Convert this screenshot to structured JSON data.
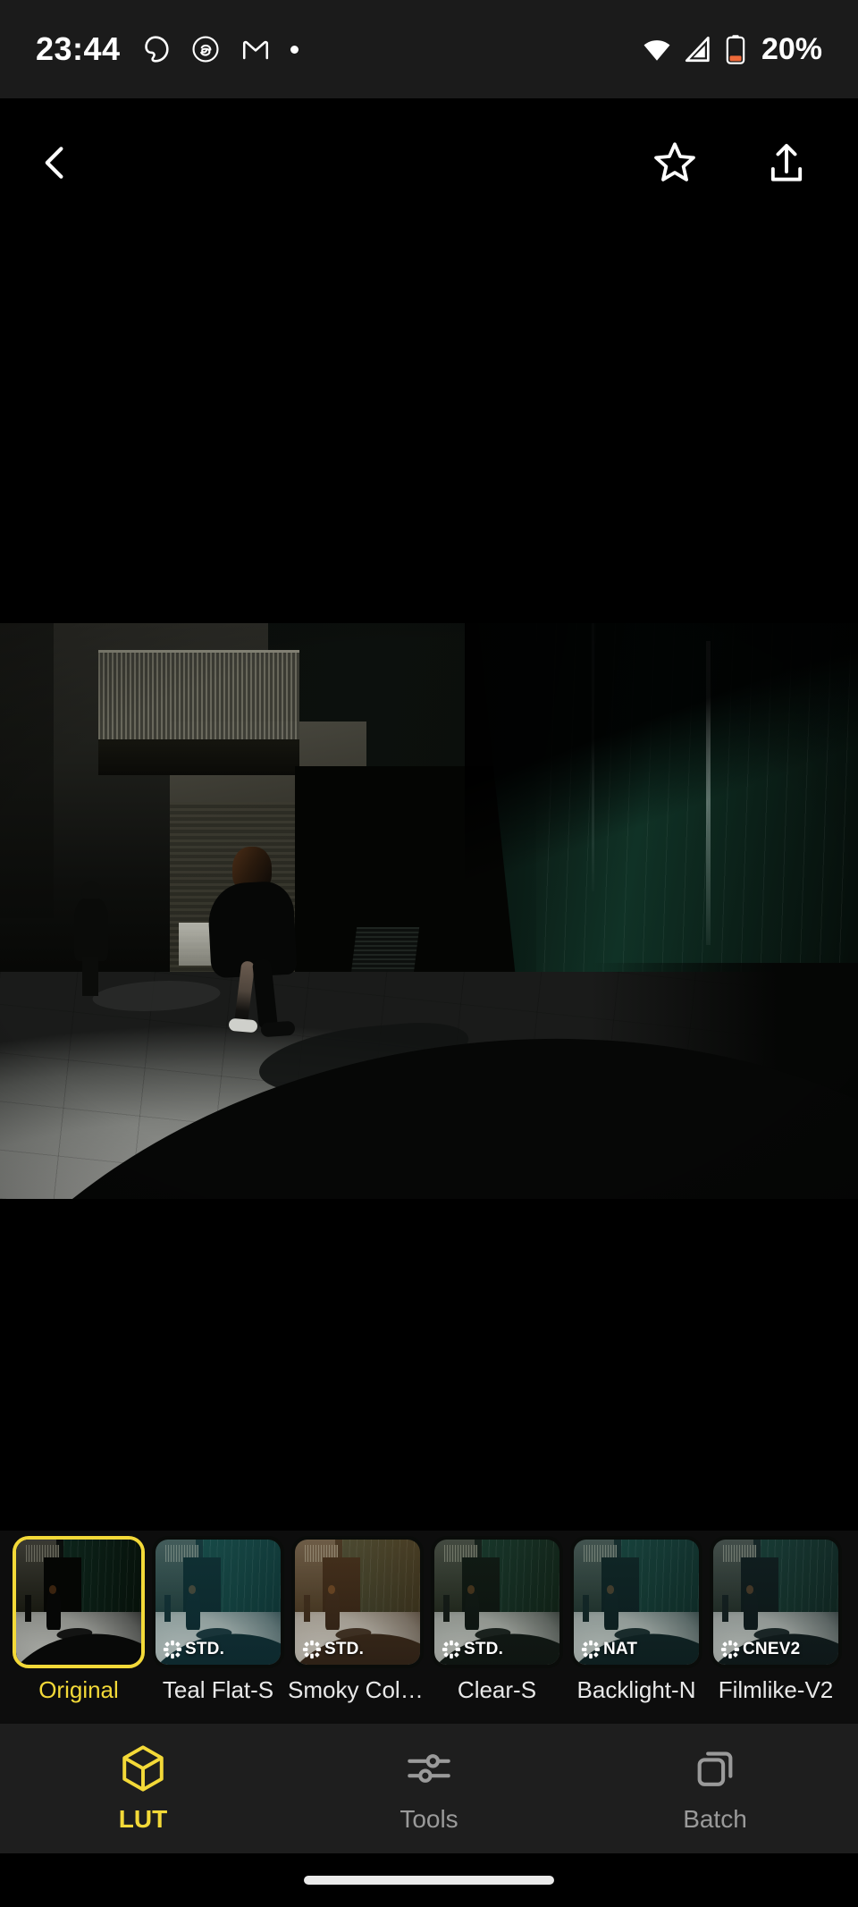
{
  "status_bar": {
    "time": "23:44",
    "battery_percent": "20%",
    "battery_color": "#ee6a3a",
    "icons": [
      "ring-icon",
      "threads-icon",
      "gmail-icon",
      "dot-icon",
      "wifi-icon",
      "cellular-signal-icon",
      "battery-icon"
    ]
  },
  "toolbar": {
    "back_icon": "chevron-left-icon",
    "favorite_icon": "star-outline-icon",
    "share_icon": "share-upload-icon"
  },
  "photo": {
    "alt": "Dark street photo of a woman walking through a patch of sunlight on paving stones beside a glass-clad building",
    "background_color": "#000000"
  },
  "lut_strip": {
    "background_color": "#0d0d0d",
    "selected_color": "#f3d938",
    "items": [
      {
        "label": "Original",
        "badge": "",
        "selected": true,
        "tint": "none"
      },
      {
        "label": "Teal Flat-S",
        "badge": "STD.",
        "selected": false,
        "tint": "teal"
      },
      {
        "label": "Smoky Colo...",
        "badge": "STD.",
        "selected": false,
        "tint": "smoky"
      },
      {
        "label": "Clear-S",
        "badge": "STD.",
        "selected": false,
        "tint": "clear"
      },
      {
        "label": "Backlight-N",
        "badge": "NAT",
        "selected": false,
        "tint": "backlight"
      },
      {
        "label": "Filmlike-V2",
        "badge": "CNEV2",
        "selected": false,
        "tint": "filmlike"
      }
    ]
  },
  "bottom_nav": {
    "active_color": "#f3d938",
    "inactive_color": "#9a9a9a",
    "items": [
      {
        "label": "LUT",
        "icon": "cube-icon",
        "active": true
      },
      {
        "label": "Tools",
        "icon": "sliders-icon",
        "active": false
      },
      {
        "label": "Batch",
        "icon": "stacked-cards-icon",
        "active": false
      }
    ]
  },
  "home_indicator": {
    "visible": true
  }
}
